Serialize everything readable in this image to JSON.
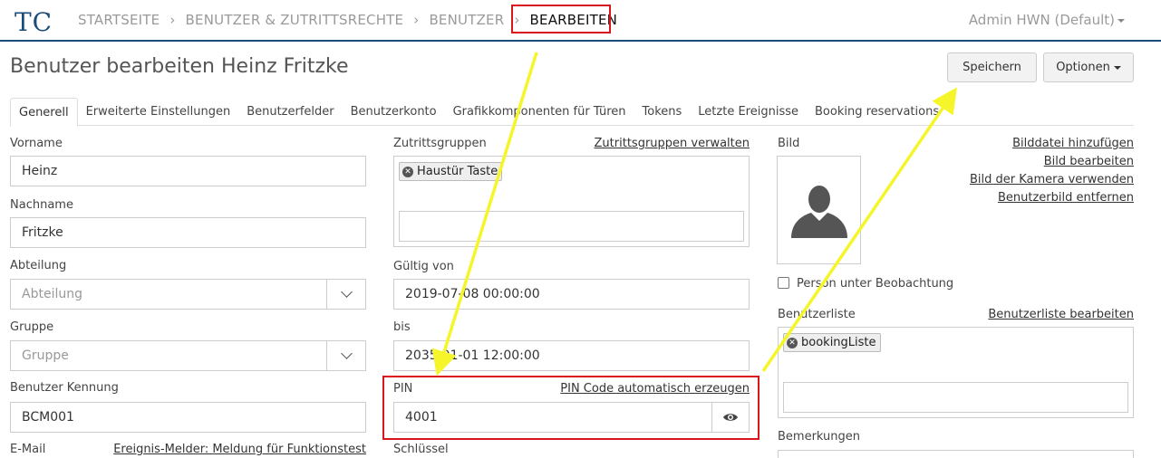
{
  "navbar": {
    "logo_text": "TCS",
    "breadcrumbs": [
      "STARTSEITE",
      "BENUTZER & ZUTRITTSRECHTE",
      "BENUTZER",
      "BEARBEITEN"
    ],
    "separator": "›",
    "user": "Admin HWN (Default)"
  },
  "page": {
    "title": "Benutzer bearbeiten Heinz Fritzke",
    "save_label": "Speichern",
    "options_label": "Optionen"
  },
  "tabs": [
    "Generell",
    "Erweiterte Einstellungen",
    "Benutzerfelder",
    "Benutzerkonto",
    "Grafikkomponenten für Türen",
    "Tokens",
    "Letzte Ereignisse",
    "Booking reservations"
  ],
  "left": {
    "vorname_label": "Vorname",
    "vorname_value": "Heinz",
    "nachname_label": "Nachname",
    "nachname_value": "Fritzke",
    "abteilung_label": "Abteilung",
    "abteilung_placeholder": "Abteilung",
    "gruppe_label": "Gruppe",
    "gruppe_placeholder": "Gruppe",
    "kennung_label": "Benutzer Kennung",
    "kennung_value": "BCM001",
    "email_label": "E-Mail",
    "email_link": "Ereignis-Melder: Meldung für Funktionstest"
  },
  "middle": {
    "zutrittsgruppen_label": "Zutrittsgruppen",
    "zutrittsgruppen_link": "Zutrittsgruppen verwalten",
    "zutrittsgruppen_tags": [
      "Haustür Taste"
    ],
    "gueltig_label": "Gültig von",
    "gueltig_value": "2019-07-08 00:00:00",
    "bis_label": "bis",
    "bis_value": "2035-01-01 12:00:00",
    "pin_label": "PIN",
    "pin_link": "PIN Code automatisch erzeugen",
    "pin_value": "4001",
    "schluessel_label": "Schlüssel"
  },
  "right": {
    "bild_label": "Bild",
    "bild_links": [
      "Bilddatei hinzufügen",
      "Bild bearbeiten",
      "Bild der Kamera verwenden",
      "Benutzerbild entfernen"
    ],
    "beobachtung_label": "Person unter Beobachtung",
    "beobachtung_checked": false,
    "benutzerliste_label": "Benutzerliste",
    "benutzerliste_link": "Benutzerliste bearbeiten",
    "benutzerliste_tags": [
      "bookingListe"
    ],
    "bemerkungen_label": "Bemerkungen"
  },
  "colors": {
    "highlight": "#d9161e",
    "arrow": "#f5f52a",
    "navbar_border": "#1d4b7a"
  },
  "icons": [
    "tcs-logo",
    "chevron-down-icon",
    "remove-tag-icon",
    "user-silhouette-icon",
    "eye-icon",
    "caret-down-icon"
  ]
}
